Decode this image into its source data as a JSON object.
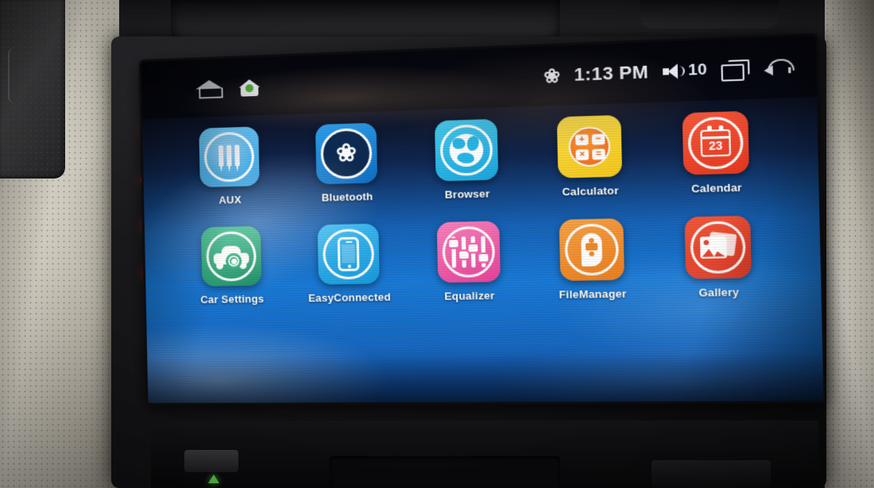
{
  "device": {
    "name": "android-car-head-unit",
    "hard_keys": [
      {
        "name": "power-key",
        "glyph": "⏻"
      },
      {
        "name": "back-key",
        "glyph": "➦"
      },
      {
        "name": "volume-up-key",
        "glyph": "🔊"
      },
      {
        "name": "volume-down-key",
        "glyph": "🔊"
      }
    ],
    "bottom_indicator": "green-triangle-indicator"
  },
  "statusbar": {
    "bluetooth_icon": "bluetooth-icon",
    "time": "1:13 PM",
    "volume_icon": "volume-icon",
    "volume_level": "10",
    "recents_icon": "recent-apps-icon",
    "back_icon": "back-arrow-icon"
  },
  "navrow": {
    "home_outline_icon": "home-outline-icon",
    "home_green_icon": "home-green-icon"
  },
  "launcher": {
    "rows": [
      [
        {
          "label": "AUX",
          "icon": "aux-icon",
          "tile_color": "#4bb3ec"
        },
        {
          "label": "Bluetooth",
          "icon": "bluetooth-icon",
          "tile_color": "#1a8fe3"
        },
        {
          "label": "Browser",
          "icon": "browser-globe-icon",
          "tile_color": "#27b6e8"
        },
        {
          "label": "Calculator",
          "icon": "calculator-icon",
          "tile_color": "#f8d72b"
        },
        {
          "label": "Calendar",
          "icon": "calendar-icon",
          "tile_color": "#f1462e",
          "day": "23"
        }
      ],
      [
        {
          "label": "Car Settings",
          "icon": "car-settings-icon",
          "tile_color": "#2aa97a"
        },
        {
          "label": "EasyConnected",
          "icon": "phone-icon",
          "tile_color": "#2bb0ee"
        },
        {
          "label": "Equalizer",
          "icon": "equalizer-icon",
          "tile_color": "#ef63a8"
        },
        {
          "label": "FileManager",
          "icon": "file-manager-icon",
          "tile_color": "#ef8a2c"
        },
        {
          "label": "Gallery",
          "icon": "gallery-icon",
          "tile_color": "#e8452f"
        }
      ]
    ]
  }
}
